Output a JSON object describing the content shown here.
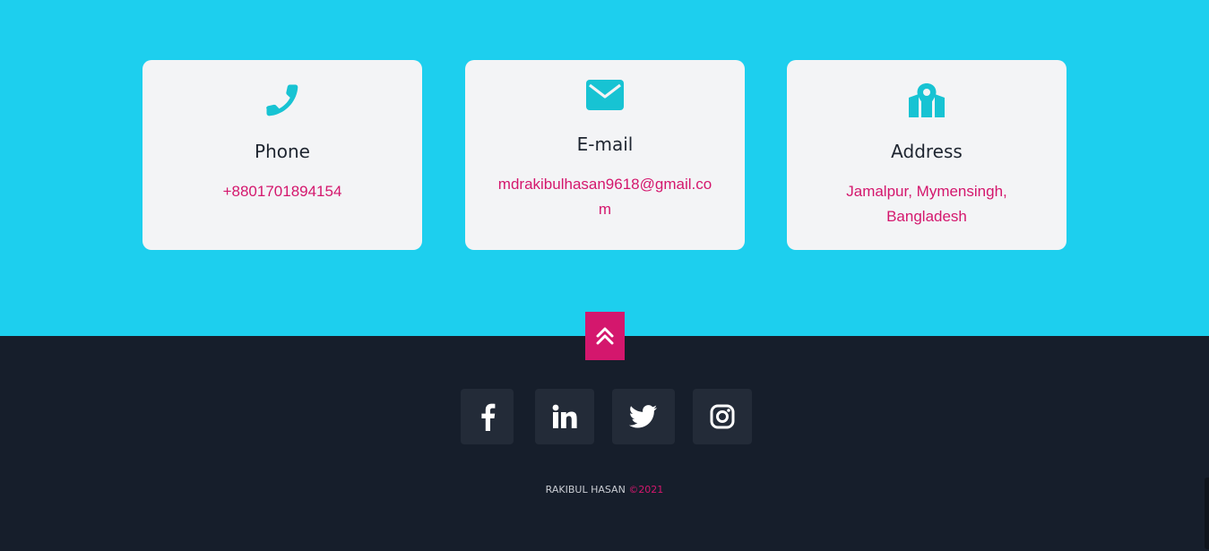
{
  "contact": {
    "phone": {
      "icon": "phone-icon",
      "title": "Phone",
      "value": "+8801701894154"
    },
    "email": {
      "icon": "envelope-icon",
      "title": "E-mail",
      "value": "mdrakibulhasan9618@gmail.com"
    },
    "address": {
      "icon": "map-marker-icon",
      "title": "Address",
      "value": "Jamalpur, Mymensingh, Bangladesh"
    }
  },
  "back_to_top": {
    "icon": "double-chevron-up-icon"
  },
  "social": [
    {
      "icon": "facebook-icon"
    },
    {
      "icon": "linkedin-icon"
    },
    {
      "icon": "twitter-icon"
    },
    {
      "icon": "instagram-icon"
    }
  ],
  "footer": {
    "name": "RAKIBUL HASAN",
    "year": "©2021"
  },
  "colors": {
    "section_bg": "#1dcfee",
    "card_bg": "#f3f4f6",
    "icon_accent": "#17c3d3",
    "link_pink": "#d4176d",
    "footer_bg": "#161e2b",
    "social_bg": "#232b38"
  }
}
